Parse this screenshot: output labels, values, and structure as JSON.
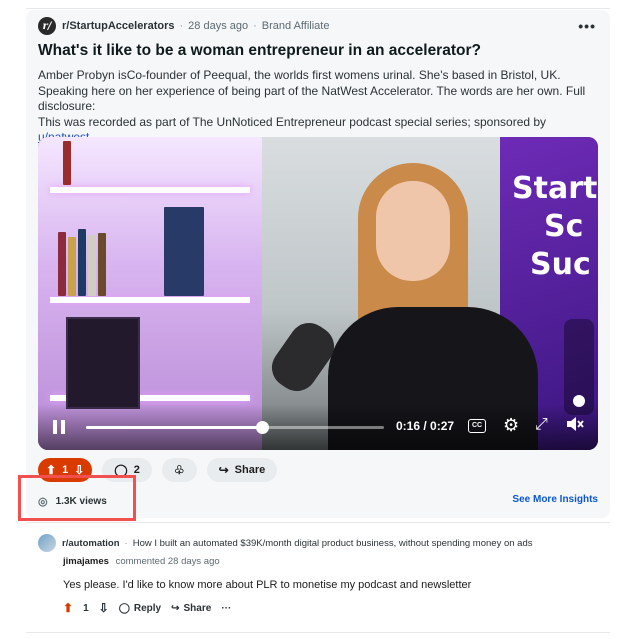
{
  "post": {
    "subreddit": "r/StartupAccelerators",
    "age": "28 days ago",
    "label": "Brand Affiliate",
    "more": "•••",
    "title": "What's it like to be a woman entrepreneur in an accelerator?",
    "body_line1": "Amber Probyn isCo-founder of Peequal, the worlds first womens urinal. She's based in Bristol, UK.",
    "body_line2": "Speaking here on her experience of being part of the NatWest Accelerator. The words are her own. Full disclosure:",
    "body_line3": "This was recorded as part of The UnNoticed Entrepreneur podcast special series; sponsored by ",
    "sponsor_link": "u/natwest"
  },
  "video": {
    "time": "0:16 / 0:27",
    "progress": 0.59,
    "cc_label": "CC",
    "banner_words": [
      "Start",
      "Sc",
      "Suc"
    ]
  },
  "actions": {
    "votes": "1",
    "comments": "2",
    "share": "Share"
  },
  "stats": {
    "views": "1.3K views",
    "insights": "See More Insights"
  },
  "comment": {
    "subreddit": "r/automation",
    "thread_title": "How I built an automated $39K/month digital product business, without spending money on ads",
    "user": "jimajames",
    "meta": "commented 28 days ago",
    "text": "Yes please. I'd like to know more about PLR to monetise my podcast and newsletter",
    "votes": "1",
    "reply": "Reply",
    "share": "Share",
    "more": "···"
  },
  "colors": {
    "vote_orange": "#d93a00",
    "link_blue": "#0b57d0",
    "highlight_red": "#f24f4f"
  }
}
